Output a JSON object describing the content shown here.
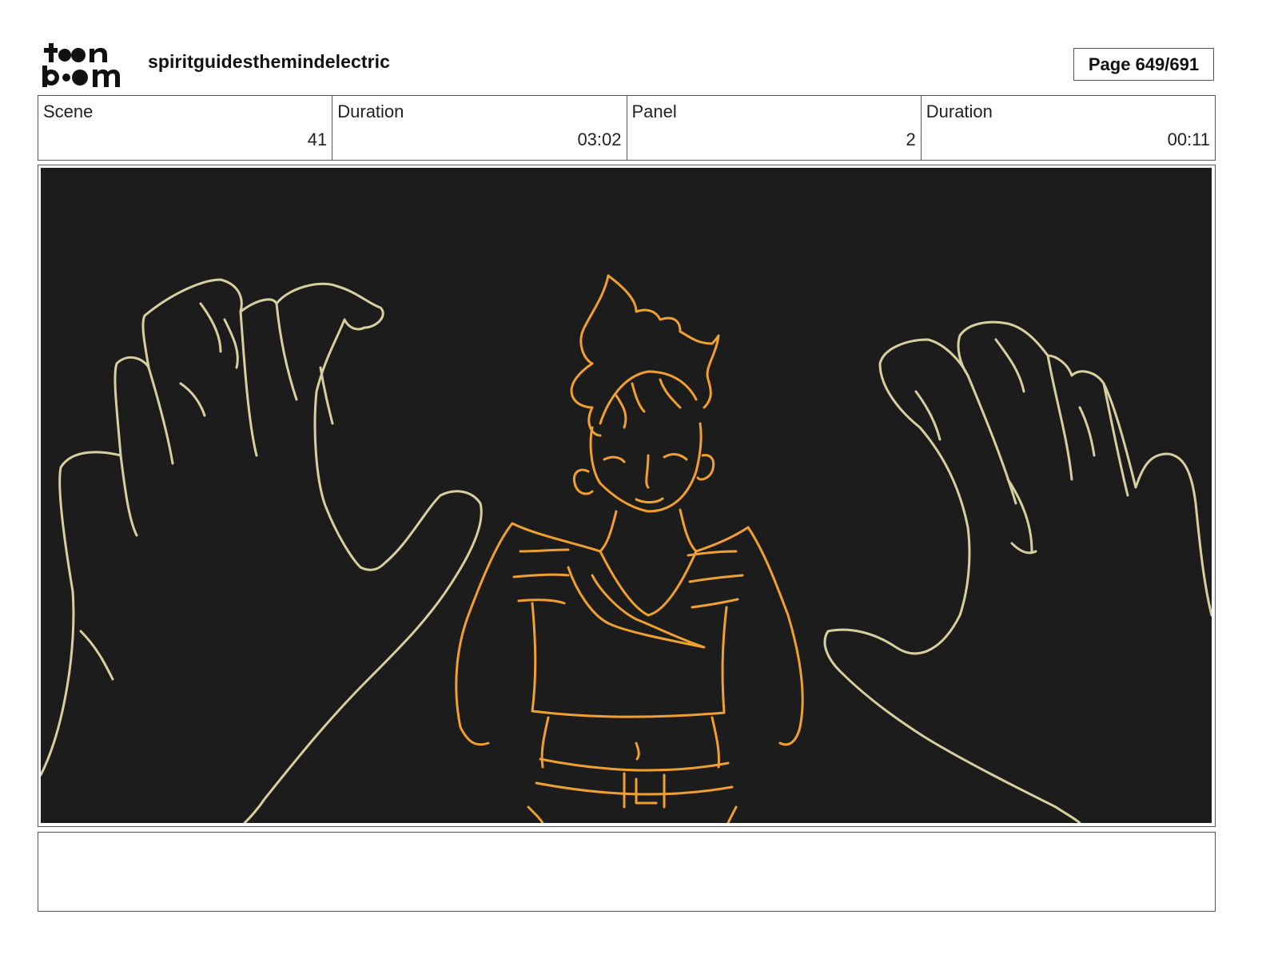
{
  "header": {
    "logo_alt": "toon boom",
    "project_title": "spiritguidesthemindelectric",
    "page_label": "Page 649/691"
  },
  "info": {
    "scene_label": "Scene",
    "scene_value": "41",
    "scene_duration_label": "Duration",
    "scene_duration_value": "03:02",
    "panel_label": "Panel",
    "panel_value": "2",
    "panel_duration_label": "Duration",
    "panel_duration_value": "00:11"
  },
  "panel": {
    "background_color": "#1c1c1c",
    "hands_line_color": "#d8cfa0",
    "figure_line_color": "#f0a030"
  },
  "notes": {
    "text": ""
  }
}
